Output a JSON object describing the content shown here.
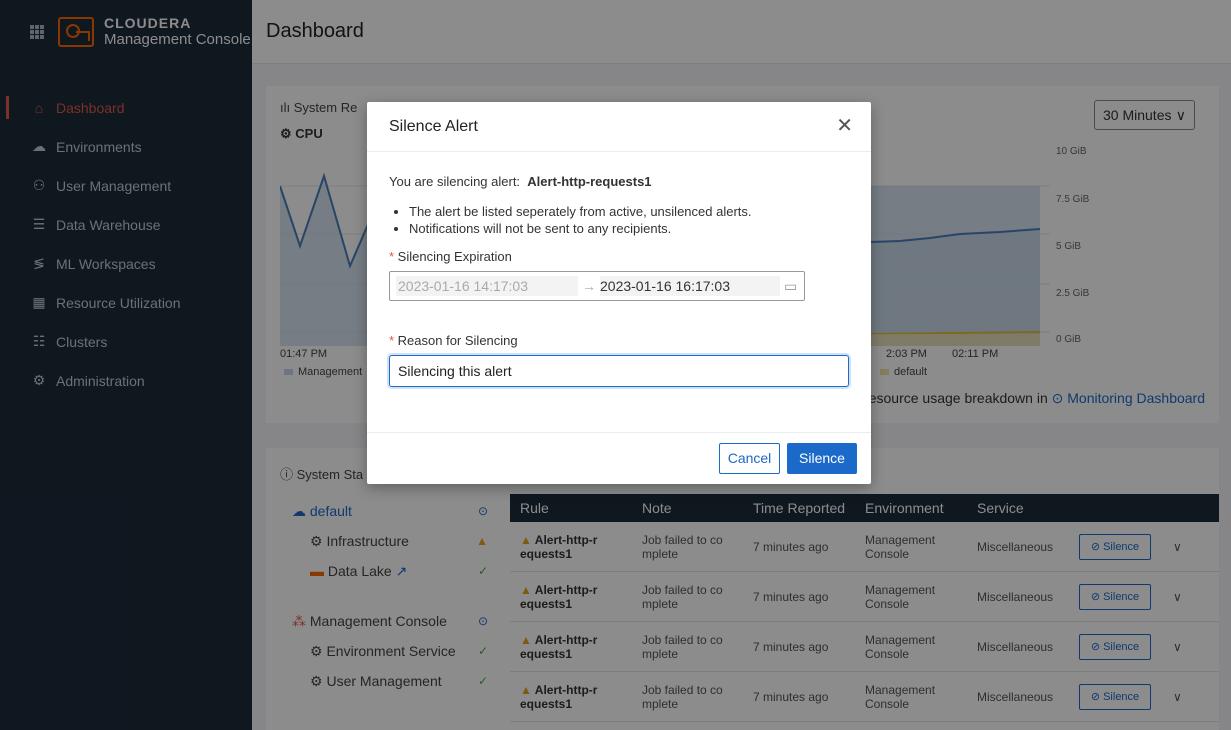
{
  "brand": {
    "line1": "CLOUDERA",
    "line2": "Management Console"
  },
  "sidebar": {
    "items": [
      {
        "label": "Dashboard",
        "icon": "home-icon",
        "active": true
      },
      {
        "label": "Environments",
        "icon": "cloud-icon"
      },
      {
        "label": "User Management",
        "icon": "users-icon"
      },
      {
        "label": "Data Warehouse",
        "icon": "warehouse-icon"
      },
      {
        "label": "ML Workspaces",
        "icon": "ml-icon"
      },
      {
        "label": "Resource Utilization",
        "icon": "resource-icon"
      },
      {
        "label": "Clusters",
        "icon": "clusters-icon"
      },
      {
        "label": "Administration",
        "icon": "gear-icon"
      }
    ]
  },
  "header": {
    "title": "Dashboard"
  },
  "resources": {
    "title": "System Re",
    "range": "30 Minutes",
    "cpu": "CPU",
    "y_ticks": [
      "10 GiB",
      "7.5 GiB",
      "5 GiB",
      "2.5 GiB",
      "0 GiB"
    ],
    "x_start": "01:47 PM",
    "x_mid1": "2:03 PM",
    "x_mid2": "02:11 PM",
    "legend1": "Management",
    "legend2": "default",
    "link_prefix": "resource usage breakdown in",
    "link_text": "Monitoring Dashboard"
  },
  "system_status": {
    "title": "System Sta",
    "tree": [
      {
        "label": "default"
      },
      {
        "label": "Infrastructure"
      },
      {
        "label": "Data Lake"
      },
      {
        "label": "Management Console"
      },
      {
        "label": "Environment Service"
      },
      {
        "label": "User Management"
      }
    ]
  },
  "alerts": {
    "columns": [
      "Rule",
      "Note",
      "Time Reported",
      "Environment",
      "Service"
    ],
    "rows": [
      {
        "rule1": "Alert-http-r",
        "rule2": "equests1",
        "note": "Job failed to co mplete",
        "time": "7 minutes ago",
        "env": "Management Console",
        "service": "Miscellaneous",
        "action": "Silence"
      },
      {
        "rule1": "Alert-http-r",
        "rule2": "equests1",
        "note": "Job failed to co mplete",
        "time": "7 minutes ago",
        "env": "Management Console",
        "service": "Miscellaneous",
        "action": "Silence"
      },
      {
        "rule1": "Alert-http-r",
        "rule2": "equests1",
        "note": "Job failed to co mplete",
        "time": "7 minutes ago",
        "env": "Management Console",
        "service": "Miscellaneous",
        "action": "Silence"
      },
      {
        "rule1": "Alert-http-r",
        "rule2": "equests1",
        "note": "Job failed to co mplete",
        "time": "7 minutes ago",
        "env": "Management Console",
        "service": "Miscellaneous",
        "action": "Silence"
      }
    ]
  },
  "modal": {
    "title": "Silence Alert",
    "intro": "You are silencing alert:",
    "alert_name": "Alert-http-requests1",
    "bullet1": "The alert be listed seperately from active, unsilenced alerts.",
    "bullet2": "Notifications will not be sent to any recipients.",
    "expiration_label": "Silencing Expiration",
    "start": "2023-01-16 14:17:03",
    "end": "2023-01-16 16:17:03",
    "reason_label": "Reason for Silencing",
    "reason_value": "Silencing this alert",
    "cancel": "Cancel",
    "confirm": "Silence"
  },
  "colors": {
    "accent": "#1b6ac9",
    "sidebar": "#1c2a3a",
    "active_nav": "#e1584b",
    "brand": "#f96702"
  }
}
